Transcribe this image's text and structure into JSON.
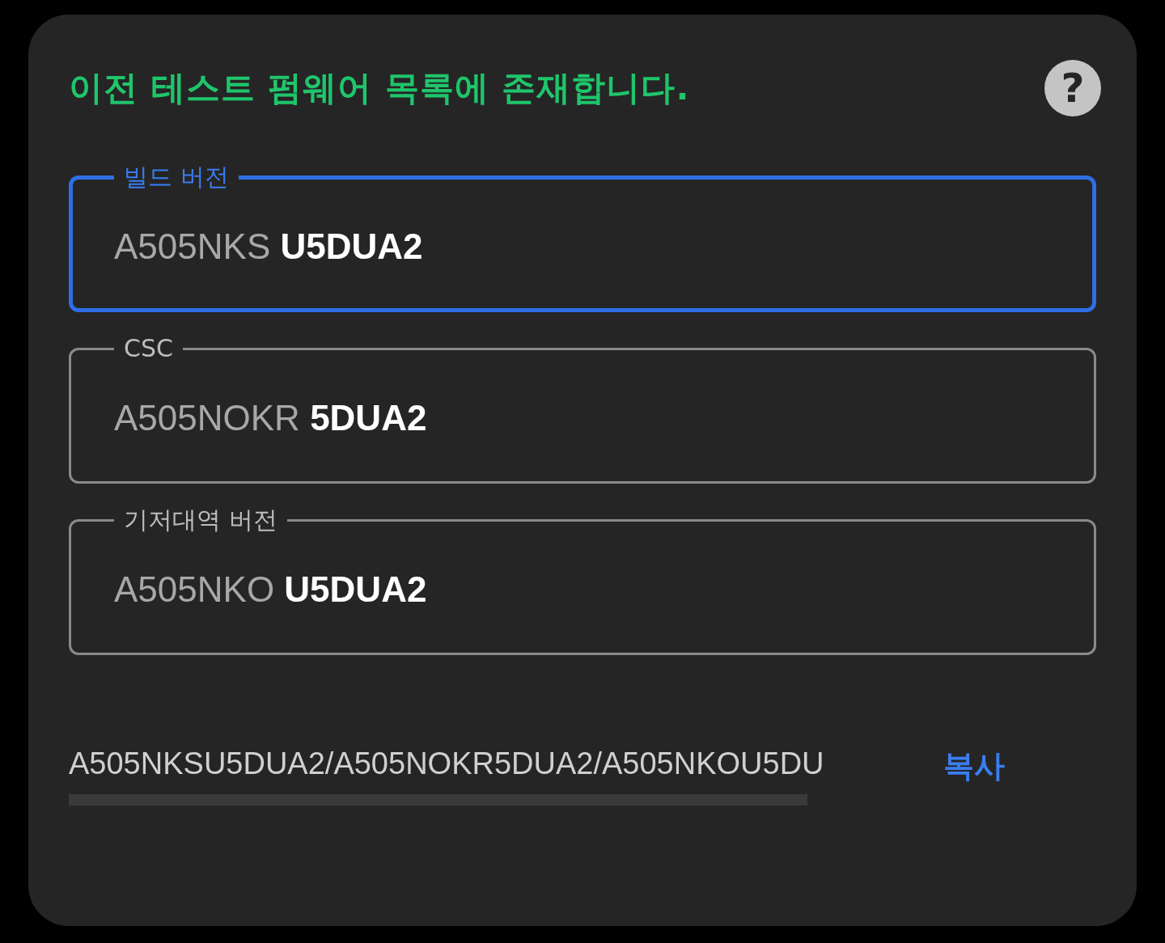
{
  "title": "이전 테스트 펌웨어 목록에 존재합니다.",
  "help_button": "?",
  "fields": [
    {
      "label": "빌드 버전",
      "prefix": "A505NKS",
      "suffix": "U5DUA2",
      "focused": true
    },
    {
      "label": "CSC",
      "prefix": "A505NOKR",
      "suffix": "5DUA2",
      "focused": false
    },
    {
      "label": "기저대역 버전",
      "prefix": "A505NKO",
      "suffix": "U5DUA2",
      "focused": false
    }
  ],
  "combined_value": "A505NKSU5DUA2/A505NOKR5DUA2/A505NKOU5DU",
  "copy_button": "복사"
}
